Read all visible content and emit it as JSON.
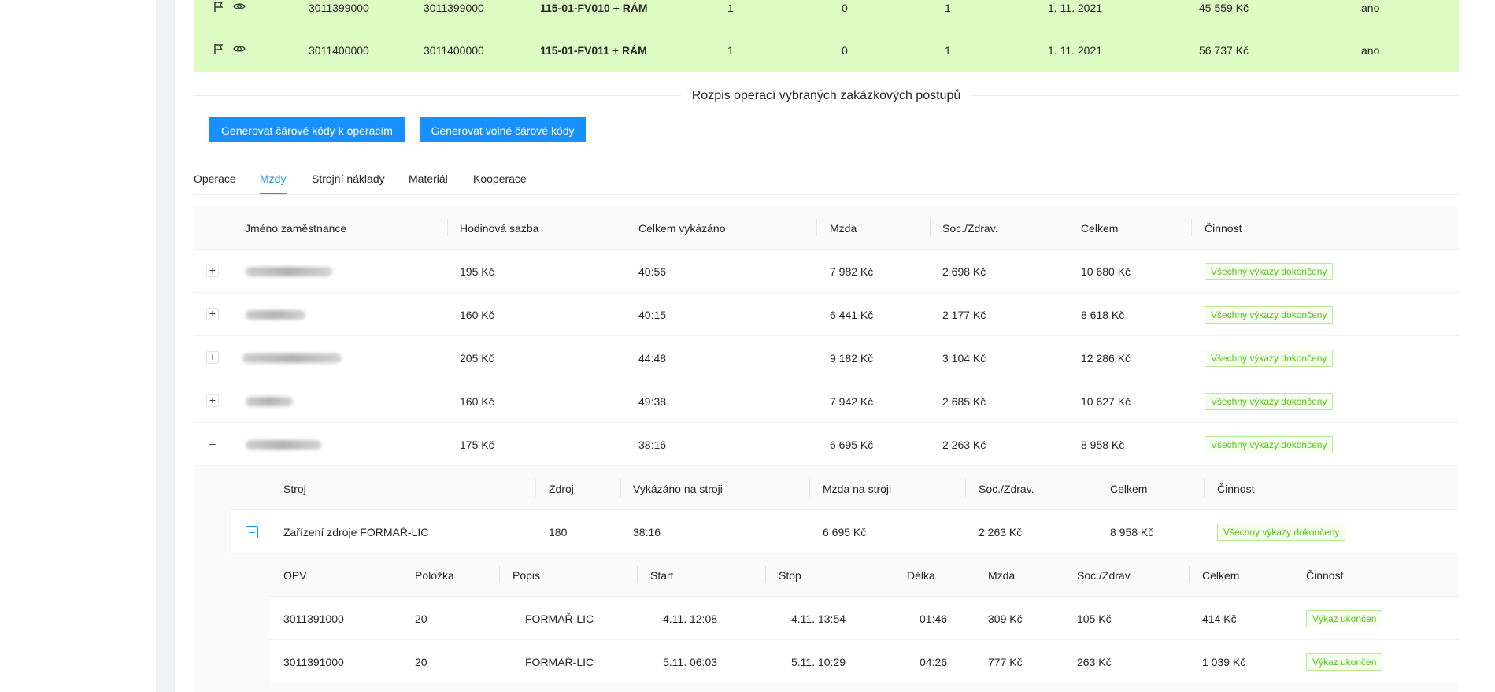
{
  "top_rows": [
    {
      "col1": "3011399000",
      "col2": "3011399000",
      "code": "115-01-FV010",
      "plus": "+",
      "ram": "RÁM",
      "n1": "1",
      "n2": "0",
      "n3": "1",
      "date": "1. 11. 2021",
      "price": "45 559 Kč",
      "flag": "ano"
    },
    {
      "col1": "3011400000",
      "col2": "3011400000",
      "code": "115-01-FV011",
      "plus": "+",
      "ram": "RÁM",
      "n1": "1",
      "n2": "0",
      "n3": "1",
      "date": "1. 11. 2021",
      "price": "56 737 Kč",
      "flag": "ano"
    }
  ],
  "section_title": "Rozpis operací vybraných zakázkových postupů",
  "buttons": {
    "gen_operations": "Generovat čárové kódy k operacím",
    "gen_free": "Generovat volné čárové kódy"
  },
  "tabs": [
    "Operace",
    "Mzdy",
    "Strojní náklady",
    "Materiál",
    "Kooperace"
  ],
  "active_tab": "Mzdy",
  "wages_table": {
    "headers": [
      "Jméno zaměstnance",
      "Hodinová sazba",
      "Celkem vykázáno",
      "Mzda",
      "Soc./Zdrav.",
      "Celkem",
      "Činnost"
    ],
    "rows": [
      {
        "expand": "+",
        "rate": "195 Kč",
        "reported": "40:56",
        "wage": "7 982 Kč",
        "social": "2 698 Kč",
        "total": "10 680 Kč",
        "status": "Všechny výkazy dokončeny"
      },
      {
        "expand": "+",
        "rate": "160 Kč",
        "reported": "40:15",
        "wage": "6 441 Kč",
        "social": "2 177 Kč",
        "total": "8 618 Kč",
        "status": "Všechny výkazy dokončeny"
      },
      {
        "expand": "+",
        "rate": "205 Kč",
        "reported": "44:48",
        "wage": "9 182 Kč",
        "social": "3 104 Kč",
        "total": "12 286 Kč",
        "status": "Všechny výkazy dokončeny"
      },
      {
        "expand": "+",
        "rate": "160 Kč",
        "reported": "49:38",
        "wage": "7 942 Kč",
        "social": "2 685 Kč",
        "total": "10 627 Kč",
        "status": "Všechny výkazy dokončeny"
      },
      {
        "expand": "–",
        "rate": "175 Kč",
        "reported": "38:16",
        "wage": "6 695 Kč",
        "social": "2 263 Kč",
        "total": "8 958 Kč",
        "status": "Všechny výkazy dokončeny"
      }
    ]
  },
  "machine_table": {
    "headers": [
      "Stroj",
      "Zdroj",
      "Vykázáno na stroji",
      "Mzda na stroji",
      "Soc./Zdrav.",
      "Celkem",
      "Činnost"
    ],
    "rows": [
      {
        "expand": "–",
        "machine": "Zařízení zdroje FORMAŘ-LIC",
        "source": "180",
        "reported": "38:16",
        "wage": "6 695 Kč",
        "social": "2 263 Kč",
        "total": "8 958 Kč",
        "status": "Všechny výkazy dokončeny"
      }
    ]
  },
  "report_table": {
    "headers": [
      "OPV",
      "Položka",
      "Popis",
      "Start",
      "Stop",
      "Délka",
      "Mzda",
      "Soc./Zdrav.",
      "Celkem",
      "Činnost"
    ],
    "rows": [
      {
        "opv": "3011391000",
        "item": "20",
        "desc": "FORMAŘ-LIC",
        "start": "4.11. 12:08",
        "stop": "4.11. 13:54",
        "length": "01:46",
        "wage": "309 Kč",
        "social": "105 Kč",
        "total": "414 Kč",
        "status": "Výkaz ukončen"
      },
      {
        "opv": "3011391000",
        "item": "20",
        "desc": "FORMAŘ-LIC",
        "start": "5.11. 06:03",
        "stop": "5.11. 10:29",
        "length": "04:26",
        "wage": "777 Kč",
        "social": "263 Kč",
        "total": "1 039 Kč",
        "status": "Výkaz ukončen"
      }
    ]
  },
  "icons": [
    "flag-icon",
    "eye-icon"
  ],
  "colors": {
    "primary": "#1890ff",
    "row_highlight": "#dcfcc4",
    "tag_green": "#52c41a"
  }
}
